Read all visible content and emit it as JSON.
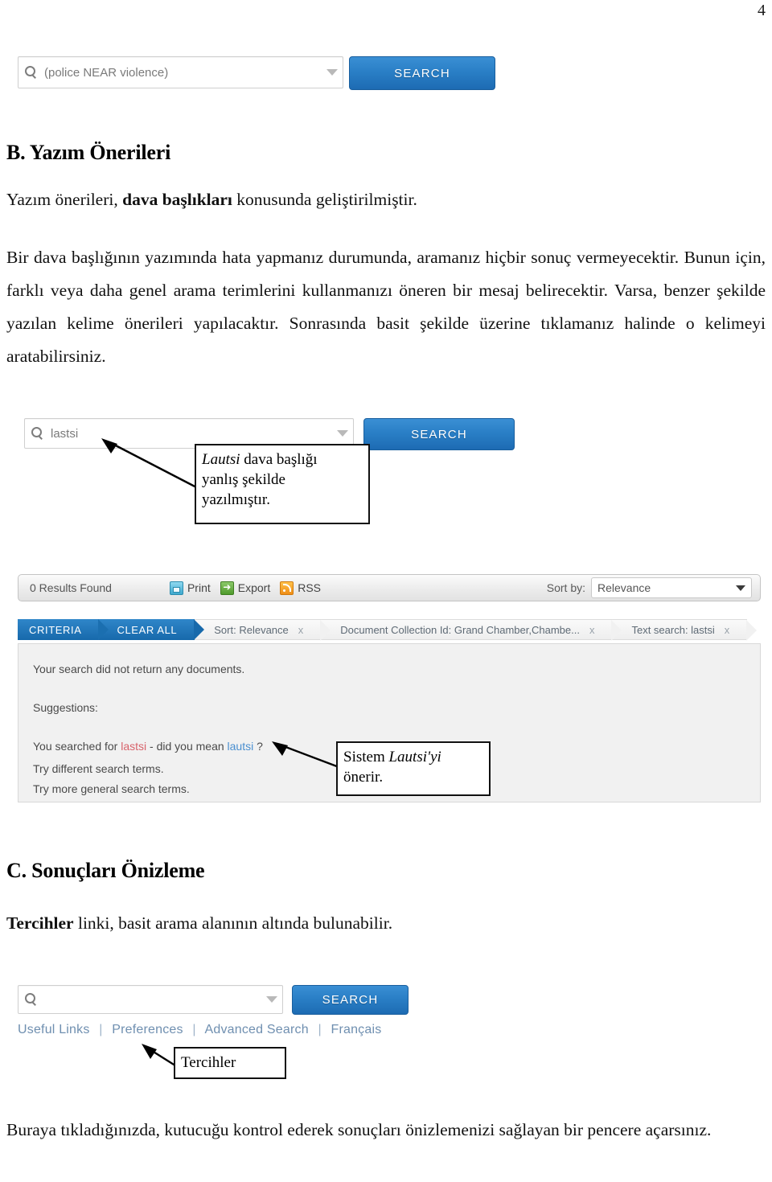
{
  "page": {
    "number": "4"
  },
  "sections": {
    "b": {
      "heading": "B. Yazım Önerileri",
      "lead_before": "Yazım önerileri, ",
      "lead_bold": "dava başlıkları",
      "lead_after": " konusunda geliştirilmiştir.",
      "body": "Bir dava başlığının yazımında hata yapmanız durumunda, aramanız hiçbir sonuç vermeyecektir. Bunun için, farklı veya daha genel arama terimlerini kullanmanızı öneren bir mesaj belirecektir. Varsa, benzer şekilde yazılan kelime önerileri yapılacaktır. Sonrasında basit şekilde üzerine tıklamanız halinde o kelimeyi aratabilirsiniz."
    },
    "c": {
      "heading": "C. Sonuçları Önizleme",
      "lead_bold": "Tercihler",
      "lead_after": " linki, basit arama alanının altında bulunabilir.",
      "body": "Buraya tıkladığınızda, kutucuğu kontrol ederek sonuçları önizlemenizi sağlayan bir pencere açarsınız."
    }
  },
  "screenshot_top": {
    "search_value": "(police NEAR violence)",
    "search_button": "SEARCH",
    "search_icon": "search-icon",
    "dropdown_icon": "chevron-down-icon"
  },
  "screenshot_middle": {
    "search_value": "lastsi",
    "search_button": "SEARCH",
    "callout_lines": [
      "Lautsi dava başlığı",
      "yanlış şekilde",
      "yazılmıştır."
    ],
    "callout_italic_word": "Lautsi"
  },
  "screenshot_results": {
    "results_found": "0 Results Found",
    "tools": [
      {
        "label": "Print",
        "icon": "print-icon"
      },
      {
        "label": "Export",
        "icon": "export-icon"
      },
      {
        "label": "RSS",
        "icon": "rss-icon"
      }
    ],
    "sort_by_label": "Sort by:",
    "sort_by_value": "Relevance",
    "criteria": [
      {
        "label": "CRITERIA",
        "type": "blue",
        "closable": false
      },
      {
        "label": "CLEAR ALL",
        "type": "blue",
        "closable": false
      },
      {
        "label": "Sort: Relevance",
        "type": "grey",
        "closable": true
      },
      {
        "label": "Document Collection Id: Grand Chamber,Chambe...",
        "type": "grey",
        "closable": true
      },
      {
        "label": "Text search: lastsi",
        "type": "grey",
        "closable": true
      }
    ],
    "close_glyph": "x",
    "no_results_text": "Your search did not return any documents.",
    "suggestions_label": "Suggestions:",
    "did_you_mean": {
      "prefix": "You searched for ",
      "bad_term": "lastsi",
      "middle": " - did you mean ",
      "good_term": "lautsi",
      "suffix": " ?"
    },
    "suggestion_lines": [
      "Try different search terms.",
      "Try more general search terms."
    ],
    "callout_lines": [
      "Sistem Lautsi'yi",
      "önerir."
    ],
    "callout_italic_word": "Lautsi'yi"
  },
  "screenshot_bottom": {
    "search_value": "",
    "search_button": "SEARCH",
    "links": [
      "Useful Links",
      "Preferences",
      "Advanced Search",
      "Français"
    ],
    "link_separator": "|",
    "callout_text": "Tercihler"
  },
  "colors": {
    "search_button_blue": "#2a7fc6",
    "criteria_blue": "#1769ab",
    "bad_term_red": "#d8636b",
    "good_term_blue": "#4a8fd0",
    "link_blue": "#6f8fb0",
    "print_icon": "#3fa9cf",
    "export_icon": "#4f9a2c",
    "rss_icon": "#ef8d16"
  }
}
